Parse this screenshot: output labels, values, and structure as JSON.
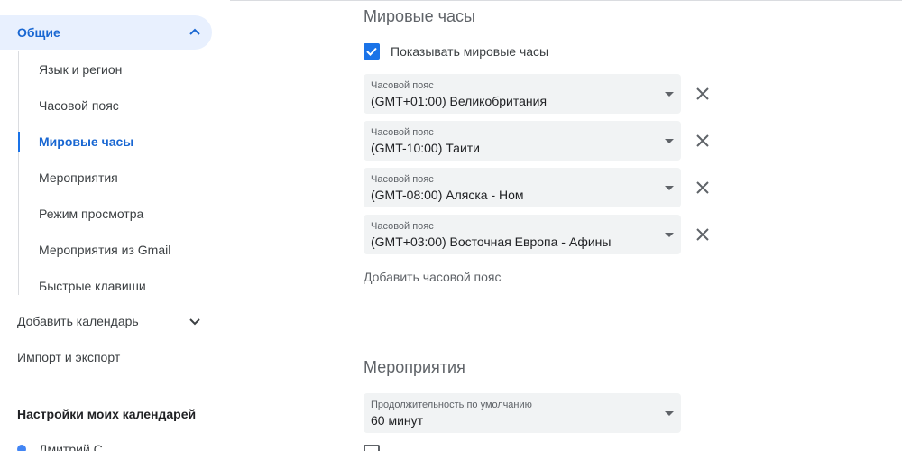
{
  "sidebar": {
    "general": {
      "label": "Общие",
      "icon": "chevron-up-icon"
    },
    "sub_items": [
      {
        "label": "Язык и регион",
        "active": false
      },
      {
        "label": "Часовой пояс",
        "active": false
      },
      {
        "label": "Мировые часы",
        "active": true
      },
      {
        "label": "Мероприятия",
        "active": false
      },
      {
        "label": "Режим просмотра",
        "active": false
      },
      {
        "label": "Мероприятия из Gmail",
        "active": false
      },
      {
        "label": "Быстрые клавиши",
        "active": false
      }
    ],
    "add_calendar": {
      "label": "Добавить календарь",
      "icon": "chevron-down-icon"
    },
    "import_export": {
      "label": "Импорт и экспорт"
    },
    "my_calendars_heading": "Настройки моих календарей",
    "calendars": [
      {
        "name": "Дмитрий С",
        "color": "#4285f4"
      }
    ]
  },
  "world_clock": {
    "title": "Мировые часы",
    "show_checkbox": {
      "label": "Показывать мировые часы",
      "checked": true
    },
    "timezone_caption": "Часовой пояс",
    "timezones": [
      "(GMT+01:00) Великобритания",
      "(GMT-10:00) Таити",
      "(GMT-08:00) Аляска - Ном",
      "(GMT+03:00) Восточная Европа - Афины"
    ],
    "add_timezone": "Добавить часовой пояс"
  },
  "events": {
    "title": "Мероприятия",
    "duration_caption": "Продолжительность по умолчанию",
    "duration_value": "60 минут",
    "next_checkbox": {
      "checked": false
    }
  },
  "colors": {
    "accent": "#1a73e8",
    "active_text": "#1967d2",
    "active_bg": "#e8f0fe",
    "select_bg": "#f1f3f4"
  }
}
